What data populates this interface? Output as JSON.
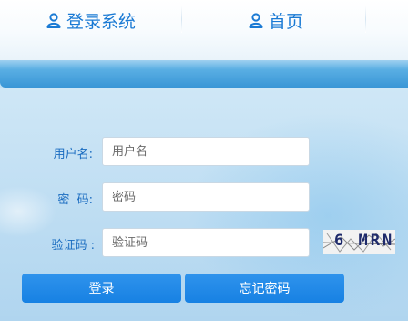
{
  "nav": {
    "login_label": "登录系统",
    "home_label": "首页",
    "icon": "user-icon"
  },
  "form": {
    "username_label": "用户名:",
    "username_placeholder": "用户名",
    "password_label": "密  码:",
    "password_placeholder": "密码",
    "captcha_label": "验证码 :",
    "captcha_placeholder": "验证码",
    "captcha_text": "6 MRN"
  },
  "buttons": {
    "login_label": "登录",
    "forgot_label": "忘记密码"
  },
  "colors": {
    "accent": "#1a7ad4",
    "button": "#1781e3",
    "band": "#3996d6"
  }
}
